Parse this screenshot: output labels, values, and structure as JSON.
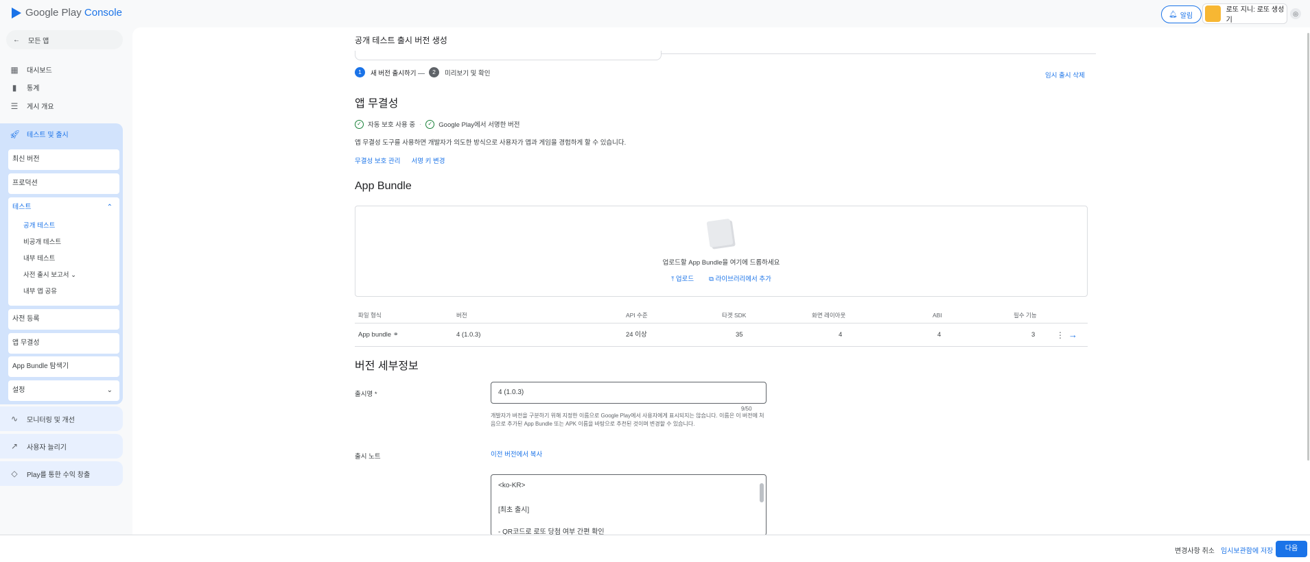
{
  "header": {
    "logo_google_play": "Google Play",
    "logo_console": "Console",
    "notifications_label": "알림",
    "account_name": "로또 지니: 로또 생성기"
  },
  "sidebar": {
    "all_apps": "모든 앱",
    "top_items": [
      {
        "label": "대시보드",
        "icon": "dashboard-icon"
      },
      {
        "label": "통계",
        "icon": "bar-chart-icon"
      },
      {
        "label": "게시 개요",
        "icon": "publishing-overview-icon"
      }
    ],
    "section_title": "테스트 및 출시",
    "section_items": [
      "최신 버전",
      "프로덕션"
    ],
    "testing": {
      "label": "테스트",
      "subitems": [
        "공개 테스트",
        "비공개 테스트",
        "내부 테스트",
        "사전 출시 보고서",
        "내부 앱 공유"
      ]
    },
    "section_items_after": [
      "사전 등록",
      "앱 무결성",
      "App Bundle 탐색기",
      "설정"
    ],
    "groups": [
      "모니터링 및 개선",
      "사용자 늘리기",
      "Play를 통한 수익 창출"
    ]
  },
  "main": {
    "page_title": "공개 테스트 출시 버전 생성",
    "steps": [
      {
        "num": "1",
        "label": "새 버전 출시하기"
      },
      {
        "num": "2",
        "label": "미리보기 및 확인"
      }
    ],
    "discard_link": "임시 출시 삭제",
    "integrity": {
      "title": "앱 무결성",
      "status1": "자동 보호 사용 중",
      "status2": "Google Play에서 서명한 버전",
      "description": "앱 무결성 도구를 사용하면 개발자가 의도한 방식으로 사용자가 앱과 게임을 경험하게 할 수 있습니다.",
      "link1": "무결성 보호 관리",
      "link2": "서명 키 변경"
    },
    "bundle": {
      "title": "App Bundle",
      "drop_text": "업로드할 App Bundle을 여기에 드롭하세요",
      "upload": "업로드",
      "add_from_library": "라이브러리에서 추가"
    },
    "table": {
      "headers": [
        "파일 형식",
        "버전",
        "API 수준",
        "타겟 SDK",
        "화면 레이아웃",
        "ABI",
        "필수 기능"
      ],
      "row": [
        "App bundle",
        "4 (1.0.3)",
        "24 이상",
        "35",
        "4",
        "4",
        "3"
      ]
    },
    "details": {
      "title": "버전 세부정보",
      "release_name_label": "출시명",
      "required_mark": "*",
      "release_name_value": "4 (1.0.3)",
      "counter": "9/50",
      "helper": "개발자가 버전을 구분하기 위해 지정한 이름으로 Google Play에서 사용자에게 표시되지는 않습니다. 이름은 이 버전에 처음으로 추가된 App Bundle 또는 APK 이름을 바탕으로 추천된 것이며 변경할 수 있습니다.",
      "release_notes_label": "출시 노트",
      "copy_previous": "이전 버전에서 복사",
      "notes_lines": [
        "<ko-KR>",
        "[최초 출시]",
        "- QR코드로 로또 당첨 여부 간편 확인"
      ]
    }
  },
  "footer": {
    "cancel": "변경사항 취소",
    "save_draft": "임시보관함에 저장",
    "next": "다음"
  },
  "colors": {
    "accent": "#1a73e8",
    "success": "#188038",
    "nav_active_bg": "#d2e3fc"
  }
}
